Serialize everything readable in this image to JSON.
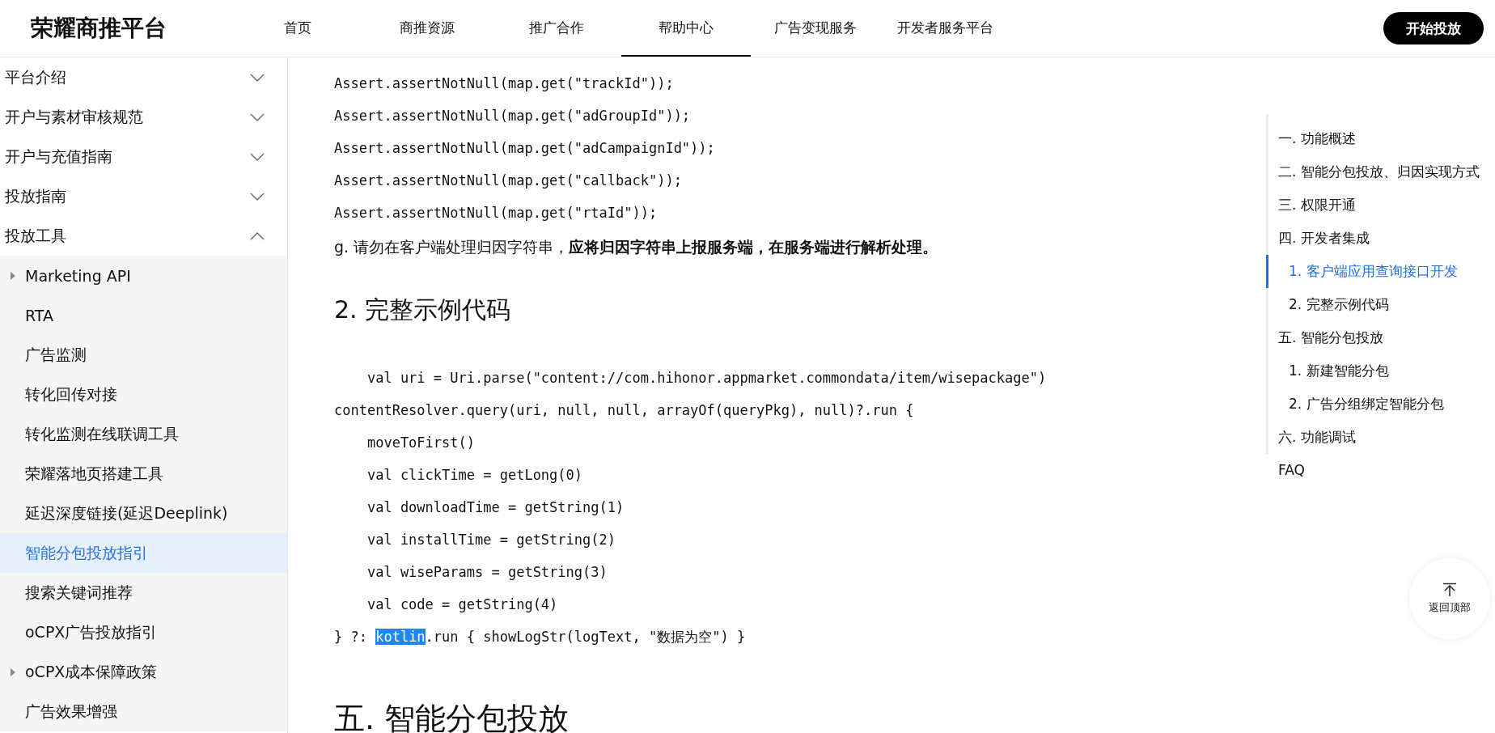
{
  "header": {
    "logo": "荣耀商推平台",
    "nav": [
      {
        "label": "首页",
        "selected": false
      },
      {
        "label": "商推资源",
        "selected": false
      },
      {
        "label": "推广合作",
        "selected": false
      },
      {
        "label": "帮助中心",
        "selected": true
      },
      {
        "label": "广告变现服务",
        "selected": false
      },
      {
        "label": "开发者服务平台",
        "selected": false
      }
    ],
    "cta": "开始投放"
  },
  "sidebar": {
    "items": [
      {
        "label": "平台介绍",
        "expanded": false
      },
      {
        "label": "开户与素材审核规范",
        "expanded": false
      },
      {
        "label": "开户与充值指南",
        "expanded": false
      },
      {
        "label": "投放指南",
        "expanded": false
      },
      {
        "label": "投放工具",
        "expanded": true,
        "children": [
          {
            "label": "Marketing API",
            "kind": "group",
            "selected": false
          },
          {
            "label": "RTA",
            "kind": "link",
            "selected": false
          },
          {
            "label": "广告监测",
            "kind": "link",
            "selected": false
          },
          {
            "label": "转化回传对接",
            "kind": "link",
            "selected": false
          },
          {
            "label": "转化监测在线联调工具",
            "kind": "link",
            "selected": false
          },
          {
            "label": "荣耀落地页搭建工具",
            "kind": "link",
            "selected": false
          },
          {
            "label": "延迟深度链接(延迟Deeplink)",
            "kind": "link",
            "selected": false
          },
          {
            "label": "智能分包投放指引",
            "kind": "link",
            "selected": true
          },
          {
            "label": "搜索关键词推荐",
            "kind": "link",
            "selected": false
          },
          {
            "label": "oCPX广告投放指引",
            "kind": "link",
            "selected": false
          },
          {
            "label": "oCPX成本保障政策",
            "kind": "group",
            "selected": false
          },
          {
            "label": "广告效果增强",
            "kind": "link",
            "selected": false
          }
        ]
      }
    ]
  },
  "content": [
    {
      "kind": "code",
      "lines": [
        {
          "text": "Assert.assertNotNull(map.get(\"trackId\"));"
        },
        {
          "text": "Assert.assertNotNull(map.get(\"adGroupId\"));"
        },
        {
          "text": "Assert.assertNotNull(map.get(\"adCampaignId\"));"
        },
        {
          "text": "Assert.assertNotNull(map.get(\"callback\"));"
        },
        {
          "text": "Assert.assertNotNull(map.get(\"rtaId\"));"
        }
      ]
    },
    {
      "kind": "paragraph",
      "text": "g. 请勿在客户端处理归因字符串，**应将归因字符串上报服务端，在服务端进行解析处理。**"
    },
    {
      "kind": "subheading",
      "text": "2. 完整示例代码"
    },
    {
      "kind": "code",
      "lines": [
        {
          "text": "    val uri = Uri.parse(\"content://com.hihonor.appmarket.commondata/item/wisepackage\")"
        },
        {
          "text": "contentResolver.query(uri, null, null, arrayOf(queryPkg), null)?.run {"
        },
        {
          "text": "    moveToFirst()"
        },
        {
          "text": "    val clickTime = getLong(0)"
        },
        {
          "text": "    val downloadTime = getString(1)"
        },
        {
          "text": "    val installTime = getString(2)"
        },
        {
          "text": "    val wiseParams = getString(3)"
        },
        {
          "text": "    val code = getString(4)"
        },
        {
          "segments": [
            {
              "text": "} ?: ",
              "selected": false
            },
            {
              "text": "kotlin",
              "selected": true
            },
            {
              "text": ".run { showLogStr(logText, \"数据为空\") }",
              "selected": false
            }
          ]
        }
      ]
    },
    {
      "kind": "heading",
      "text": "五. 智能分包投放"
    }
  ],
  "toc": [
    {
      "label": "一. 功能概述",
      "selected": false
    },
    {
      "label": "二. 智能分包投放、归因实现方式",
      "selected": false
    },
    {
      "label": "三. 权限开通",
      "selected": false
    },
    {
      "label": "四. 开发者集成",
      "selected": false,
      "children": [
        {
          "label": "1. 客户端应用查询接口开发",
          "selected": true
        },
        {
          "label": "2. 完整示例代码",
          "selected": false
        }
      ]
    },
    {
      "label": "五. 智能分包投放",
      "selected": false,
      "children": [
        {
          "label": "1. 新建智能分包",
          "selected": false
        },
        {
          "label": "2. 广告分组绑定智能分包",
          "selected": false
        }
      ]
    },
    {
      "label": "六. 功能调试",
      "selected": false
    },
    {
      "label": "FAQ",
      "selected": false
    }
  ],
  "back_to_top": "返回顶部"
}
